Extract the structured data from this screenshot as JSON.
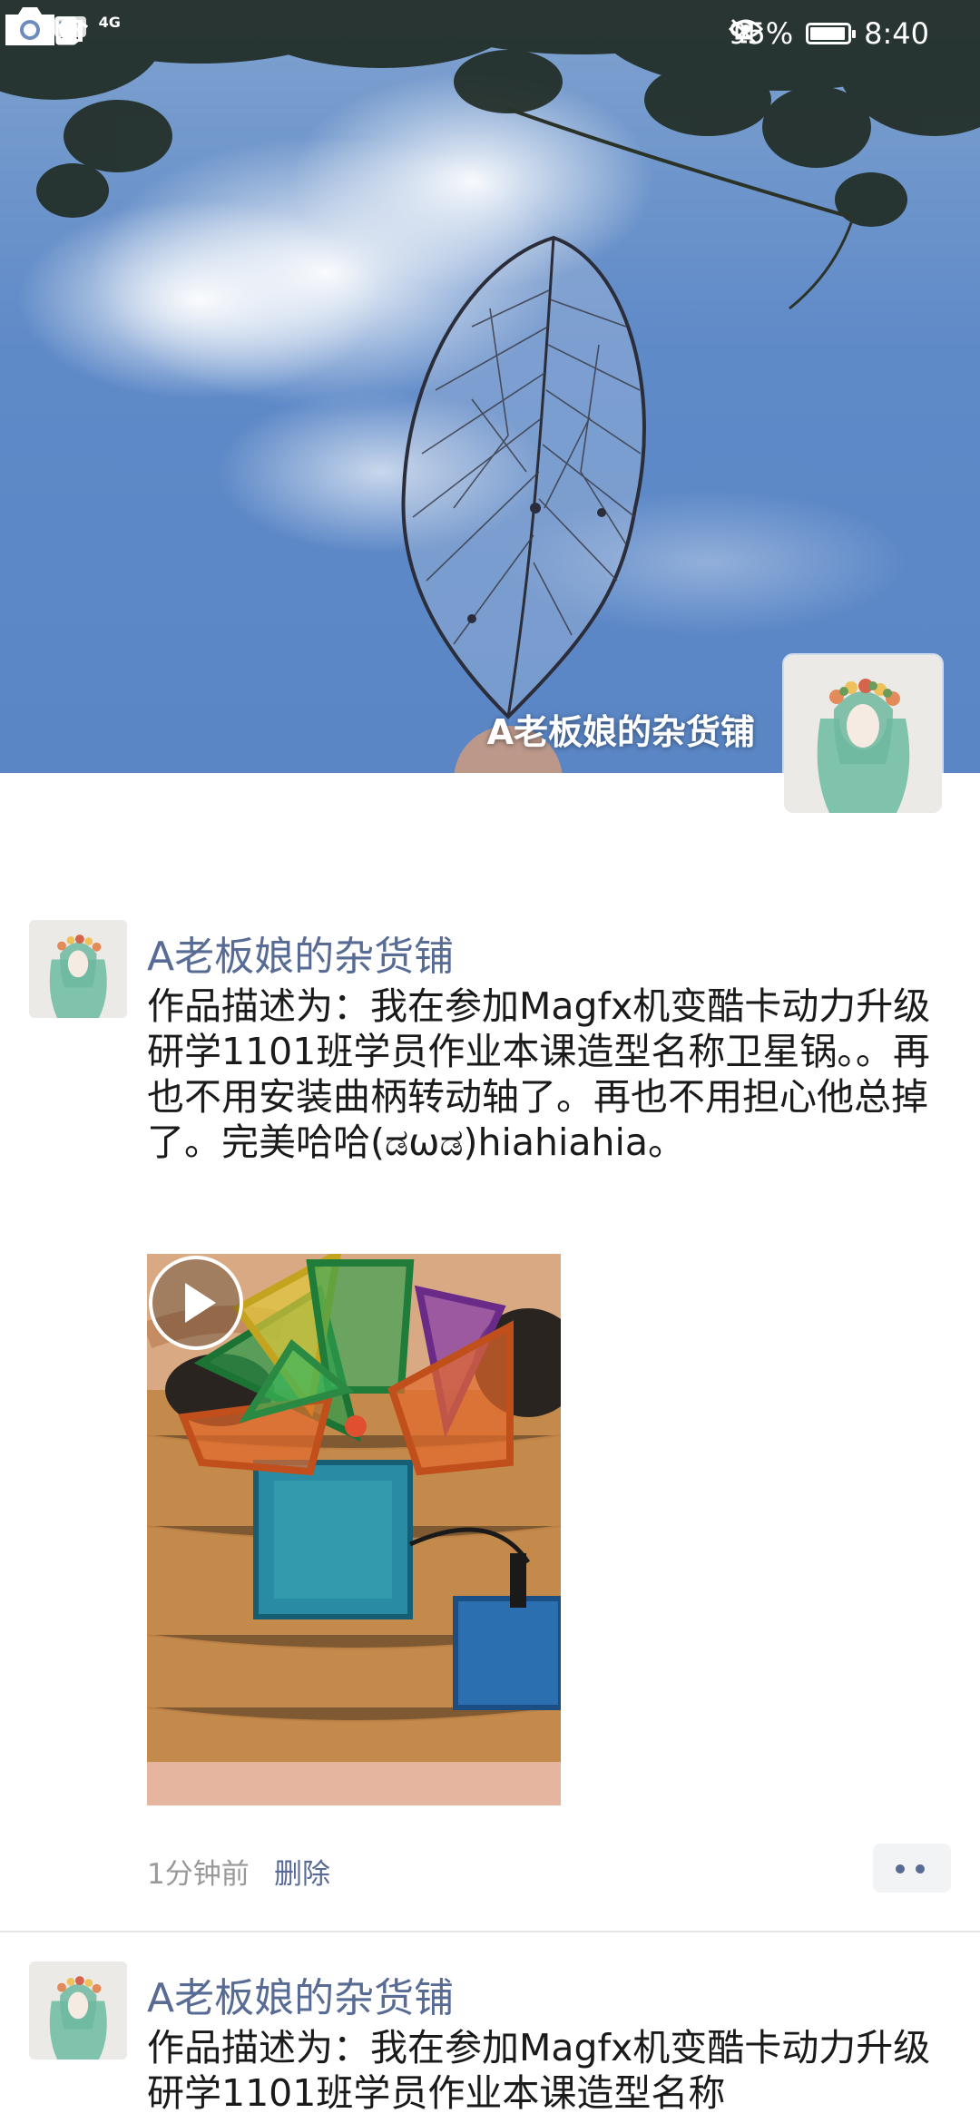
{
  "status_bar": {
    "hd": "HD",
    "network": "4G",
    "battery_percent": "95%",
    "battery_level": 0.95,
    "time": "8:40",
    "icons": [
      "signal-icon",
      "wifi-icon",
      "upload-icon",
      "qq-icon",
      "eye-icon",
      "mute-bell-icon",
      "battery-icon"
    ]
  },
  "nav": {
    "back_icon": "chevron-left-icon",
    "camera_icon": "camera-icon"
  },
  "profile": {
    "name": "A老板娘的杂货铺"
  },
  "posts": [
    {
      "author": "A老板娘的杂货铺",
      "text": "作品描述为：我在参加Magfx机变酷卡动力升级研学1101班学员作业本课造型名称卫星锅。。再也不用安装曲柄转动轴了。再也不用担心他总掉了。完美哈哈(ಡωಡ)hiahiahia。",
      "media": "video",
      "time": "1分钟前",
      "delete_label": "删除"
    },
    {
      "author": "A老板娘的杂货铺",
      "text": "作品描述为：我在参加Magfx机变酷卡动力升级研学1101班学员作业本课造型名称"
    }
  ],
  "colors": {
    "link": "#576b95",
    "text": "#1a1a1a",
    "meta": "#999999"
  }
}
